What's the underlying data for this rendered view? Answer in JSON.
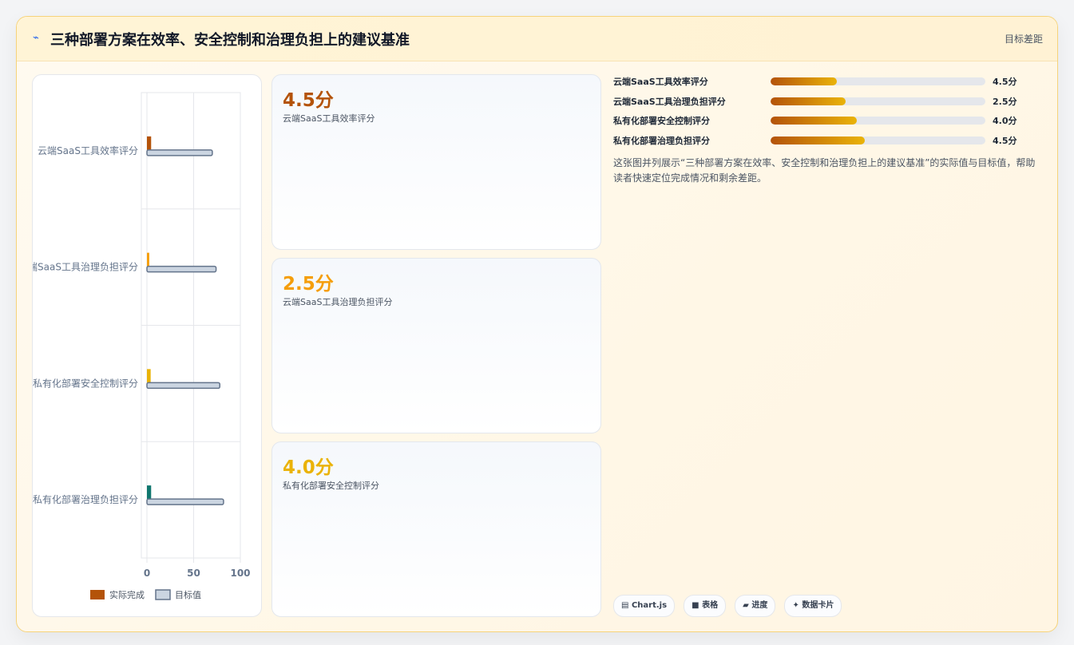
{
  "header": {
    "icon": "lightning-icon",
    "title": "三种部署方案在效率、安全控制和治理负担上的建议基准",
    "link": "目标差距"
  },
  "chart_data": {
    "type": "bar",
    "orientation": "horizontal",
    "categories": [
      "云端SaaS工具效率评分",
      "云端SaaS工具治理负担评分",
      "私有化部署安全控制评分",
      "私有化部署治理负担评分"
    ],
    "series": [
      {
        "name": "实际完成",
        "values": [
          4.5,
          2.5,
          4.0,
          4.5
        ],
        "colors": [
          "#b45309",
          "#f59e0b",
          "#eab308",
          "#0f766e"
        ]
      },
      {
        "name": "目标值",
        "values": [
          70,
          74,
          78,
          82
        ],
        "color": "#cbd5e1",
        "border": "#64748b"
      }
    ],
    "xlim": [
      0,
      100
    ],
    "xticks": [
      "0",
      "50",
      "100"
    ],
    "grid": true,
    "legend": "bottom"
  },
  "kpis": [
    {
      "value": "4.5分",
      "label": "云端SaaS工具效率评分",
      "color": "#b45309"
    },
    {
      "value": "2.5分",
      "label": "云端SaaS工具治理负担评分",
      "color": "#f59e0b"
    },
    {
      "value": "4.0分",
      "label": "私有化部署安全控制评分",
      "color": "#eab308"
    }
  ],
  "progress": [
    {
      "label": "云端SaaS工具效率评分",
      "value": "4.5分",
      "percent": 31
    },
    {
      "label": "云端SaaS工具治理负担评分",
      "value": "2.5分",
      "percent": 35
    },
    {
      "label": "私有化部署安全控制评分",
      "value": "4.0分",
      "percent": 40
    },
    {
      "label": "私有化部署治理负担评分",
      "value": "4.5分",
      "percent": 44
    }
  ],
  "description": "这张图并列展示“三种部署方案在效率、安全控制和治理负担上的建议基准”的实际值与目标值，帮助读者快速定位完成情况和剩余差距。",
  "tags": [
    {
      "icon": "chart-icon",
      "glyph": "▤",
      "label": "Chart.js"
    },
    {
      "icon": "table-icon",
      "glyph": "■",
      "label": "表格"
    },
    {
      "icon": "progress-icon",
      "glyph": "▰",
      "label": "进度"
    },
    {
      "icon": "card-icon",
      "glyph": "✦",
      "label": "数据卡片"
    }
  ]
}
